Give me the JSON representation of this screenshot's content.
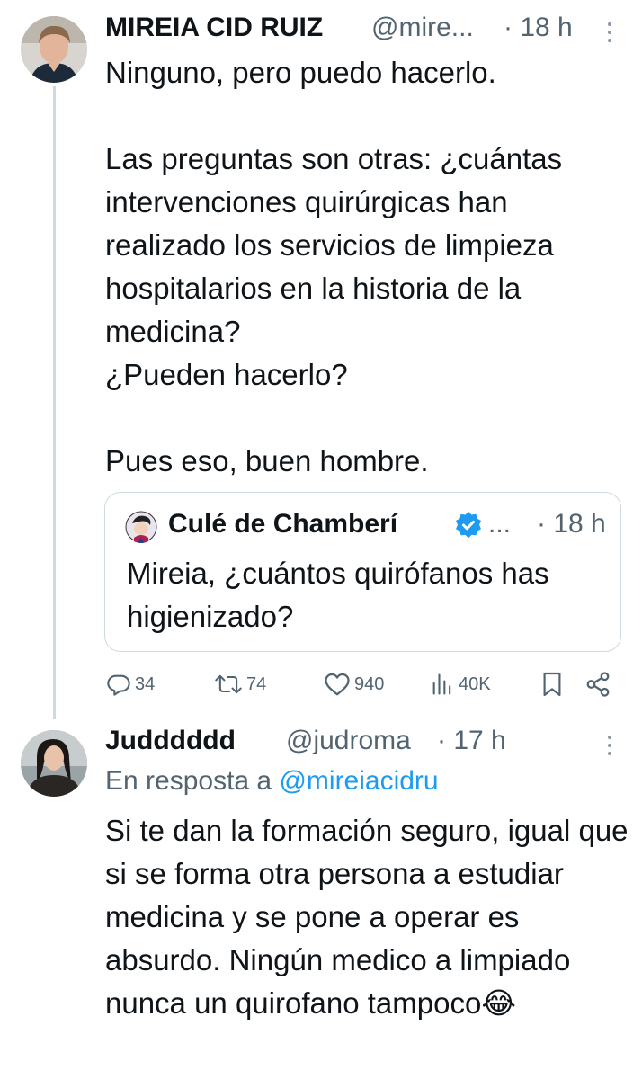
{
  "tweet1": {
    "name": "MIREIA CID RUIZ",
    "handle": "@mire...",
    "time": "· 18 h",
    "body": "Ninguno, pero puedo hacerlo.\n\nLas preguntas son otras: ¿cuántas intervenciones quirúrgicas han realizado los servicios de limpieza hospitalarios en la historia de la medicina?\n¿Pueden hacerlo?\n\nPues eso, buen hombre.",
    "quote": {
      "name": "Culé de Chamberí",
      "ellipsis": "...",
      "time": "· 18 h",
      "body": "Mireia, ¿cuántos quirófanos has higienizado?"
    },
    "actions": {
      "replies": "34",
      "retweets": "74",
      "likes": "940",
      "views": "40K"
    }
  },
  "tweet2": {
    "name": "Judddddd",
    "handle": "@judroma",
    "time": "· 17 h",
    "reply_prefix": "En resposta a ",
    "reply_mention": "@mireiacidru",
    "body": "Si te dan la formación seguro, igual que si se forma otra persona a estudiar medicina y se pone a operar es absurdo. Ningún medico a limpiado nunca un quirofano tampoco",
    "emoji": "😂"
  },
  "colors": {
    "text": "#0f1419",
    "secondary": "#536471",
    "link": "#1d9bf0",
    "verified": "#1d9bf0",
    "border": "#cfd9de"
  }
}
